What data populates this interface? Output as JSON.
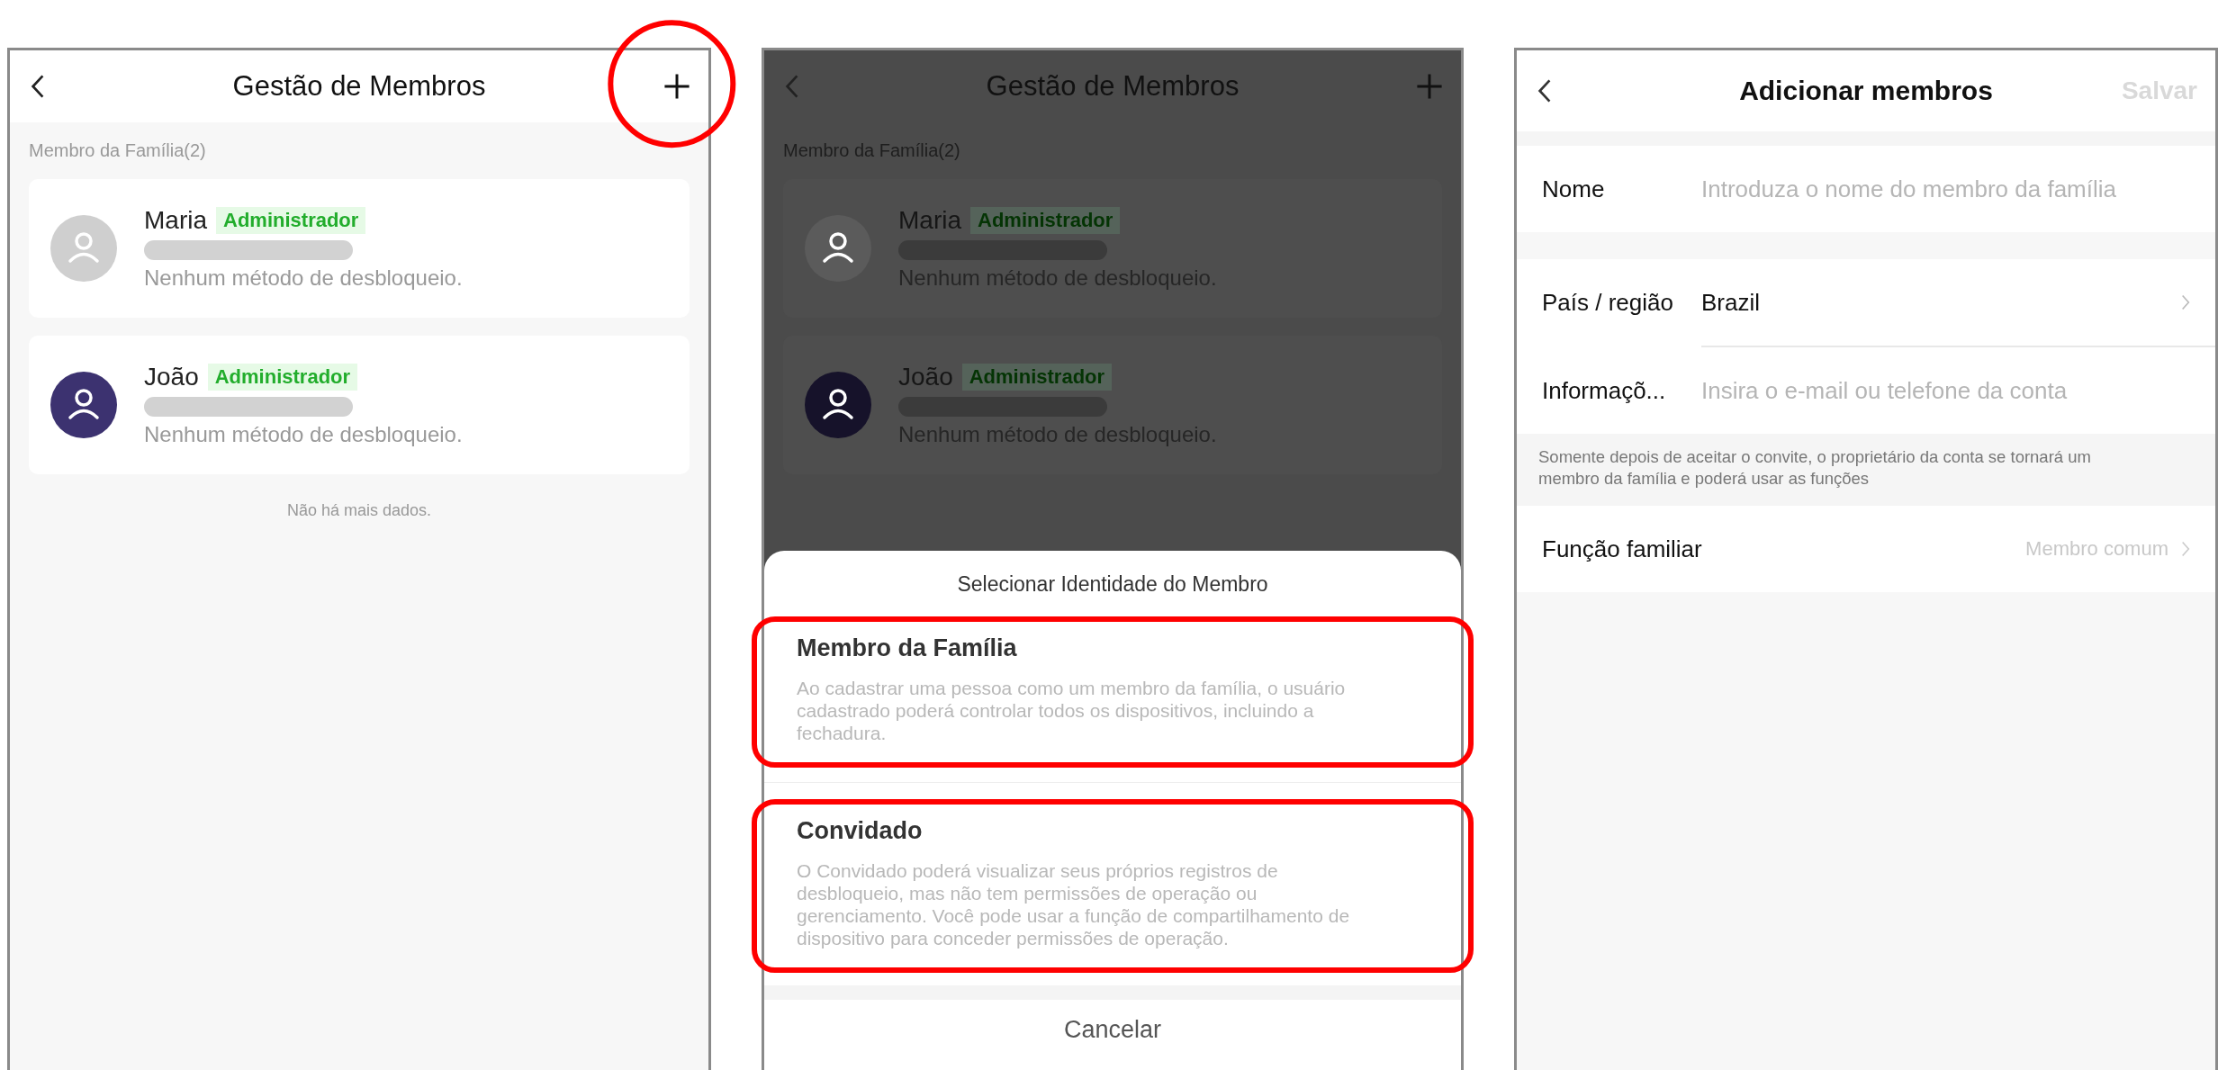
{
  "screens": [
    {
      "kind": "member_list",
      "dimmed": false,
      "title": "Gestão de Membros",
      "add_highlighted": true,
      "section_label": "Membro da Família(2)",
      "members": [
        {
          "name": "Maria",
          "role": "Administrador",
          "status": "Nenhum método de desbloqueio.",
          "color": "#cfcfcf"
        },
        {
          "name": "João",
          "role": "Administrador",
          "status": "Nenhum método de desbloqueio.",
          "color": "#3c3270"
        }
      ],
      "footer": "Não há mais dados."
    },
    {
      "kind": "member_list",
      "dimmed": true,
      "title": "Gestão de Membros",
      "add_highlighted": false,
      "section_label": "Membro da Família(2)",
      "members": [
        {
          "name": "Maria",
          "role": "Administrador",
          "status": "Nenhum método de desbloqueio.",
          "color": "#5b5b5b"
        },
        {
          "name": "João",
          "role": "Administrador",
          "status": "Nenhum método de desbloqueio.",
          "color": "#16122a"
        }
      ],
      "sheet": {
        "title": "Selecionar Identidade do Membro",
        "options": [
          {
            "title": "Membro da Família",
            "description": "Ao cadastrar uma pessoa como um membro da família, o usuário cadastrado poderá controlar todos os dispositivos, incluindo a fechadura.",
            "highlighted": true
          },
          {
            "title": "Convidado",
            "description": "O Convidado poderá visualizar seus próprios registros de desbloqueio, mas não tem permissões de operação ou gerenciamento. Você pode usar a função de compartilhamento de dispositivo para conceder permissões de operação.",
            "highlighted": true
          }
        ],
        "cancel": "Cancelar"
      }
    },
    {
      "kind": "add_form",
      "title": "Adicionar membros",
      "save": {
        "label": "Salvar",
        "disabled": true
      },
      "groups": [
        {
          "rows": [
            {
              "kind": "input",
              "label": "Nome",
              "placeholder": "Introduza o nome do membro da família"
            }
          ]
        },
        {
          "rows": [
            {
              "kind": "select",
              "label": "País / região",
              "value": "Brazil"
            },
            {
              "kind": "input",
              "label": "Informaçõ...",
              "placeholder": "Insira o e-mail ou telefone da conta"
            }
          ],
          "note": "Somente depois de aceitar o convite, o proprietário da conta se tornará um membro da família e poderá usar as funções"
        },
        {
          "rows": [
            {
              "kind": "option",
              "label": "Função familiar",
              "value": "Membro comum"
            }
          ]
        }
      ]
    }
  ]
}
